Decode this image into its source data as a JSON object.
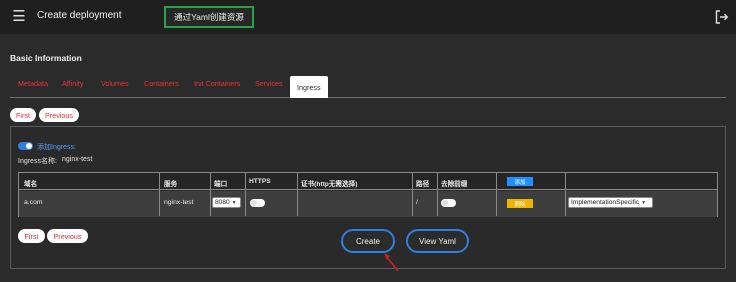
{
  "header": {
    "title": "Create deployment",
    "yaml_button_label": "通过Yaml创建资源"
  },
  "section_title": "Basic Information",
  "tabs": [
    {
      "label": "Metadata"
    },
    {
      "label": "Affinity"
    },
    {
      "label": "Volumes"
    },
    {
      "label": "Containers"
    },
    {
      "label": "Init Containers"
    },
    {
      "label": "Services"
    },
    {
      "label": "Ingress"
    }
  ],
  "active_tab": "Ingress",
  "nav_top": {
    "first_label": "First",
    "previous_label": "Previous"
  },
  "ingress": {
    "add_toggle_label": "添加Ingress:",
    "add_toggle_on": true,
    "name_label": "Ingress名称:",
    "name_value": "nginx-test"
  },
  "table": {
    "headers": {
      "domain": "域名",
      "service": "服务",
      "port": "端口",
      "https": "HTTPS",
      "cert": "证书(http无需选择)",
      "path": "路径",
      "strip_prefix": "去除前缀",
      "add_label": "添加"
    },
    "row": {
      "domain": "a.com",
      "service": "nginx-test",
      "port": "8080",
      "https_on": false,
      "cert": "",
      "path": "/",
      "strip_prefix_on": false,
      "delete_label": "删除",
      "path_type": "ImplementationSpecific"
    }
  },
  "nav_bottom": {
    "first_label": "First",
    "previous_label": "Previous"
  },
  "actions": {
    "create_label": "Create",
    "view_yaml_label": "View Yaml"
  },
  "colors": {
    "accent_blue": "#2f7ee0",
    "tab_red": "#e8333a",
    "green_border": "#27a347",
    "badge_yellow": "#f0b400",
    "arrow_red": "#cc2222"
  }
}
